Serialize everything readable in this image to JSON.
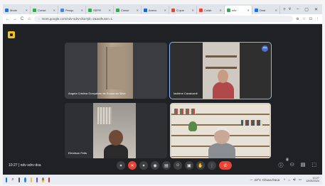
{
  "browser": {
    "tabs": [
      {
        "label": "Mode",
        "color": "#1a73e8"
      },
      {
        "label": "Conse",
        "color": "#34a853"
      },
      {
        "label": "Pesqu",
        "color": "#4285f4"
      },
      {
        "label": "SEPR",
        "color": "#34a853"
      },
      {
        "label": "Conse",
        "color": "#34a853"
      },
      {
        "label": "Anexo",
        "color": "#1967d2"
      },
      {
        "label": "O que",
        "color": "#ea4335"
      },
      {
        "label": "Colab",
        "color": "#ea4335"
      },
      {
        "label": "ndv",
        "color": "#34a853",
        "active": true
      },
      {
        "label": "Dear",
        "color": "#1a73e8"
      }
    ],
    "new_tab": "+",
    "window_controls": [
      "v",
      "–",
      "▢",
      "✕"
    ],
    "url": "meet.google.com/ndv-sdrv-dsa?pli=1&authuser=1",
    "nav": [
      "←",
      "→",
      "C",
      "⌂"
    ],
    "addr_icons": [
      "⊕",
      "☆",
      "⊡",
      "⋮"
    ]
  },
  "meet": {
    "participants": [
      {
        "name": "Angela Cristina Gonçalves de Souza da Silva"
      },
      {
        "name": "Iaciléne Cavalcanti"
      },
      {
        "name": "Elenilson Feits"
      },
      {
        "name": ""
      }
    ],
    "more_dots": "•••",
    "time": "10:27",
    "meeting_code": "ndv-sdrv-dsa",
    "separator": "|",
    "controls": [
      "▾",
      "✕",
      "▾",
      "◉",
      "▤",
      "☺",
      "▣",
      "✋",
      "⋮",
      "✆"
    ],
    "right_controls": [
      "ⓘ",
      "⚇",
      "▤",
      "⬚"
    ],
    "participant_badge": "6"
  },
  "taskbar": {
    "weather": "23°C  Chuva fraca",
    "tray": [
      "^",
      "⌂",
      "◂)",
      "▭"
    ],
    "clock_time": "10:27",
    "clock_date": "12/05/2024"
  }
}
